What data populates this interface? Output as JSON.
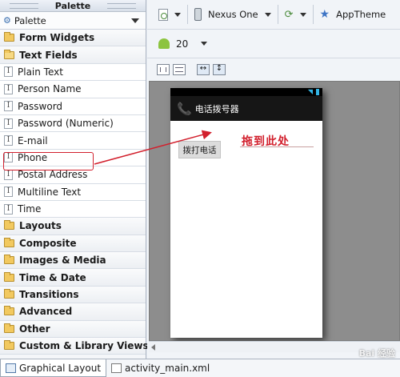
{
  "palette": {
    "title": "Palette",
    "dropdown_label": "Palette",
    "rows": [
      {
        "type": "category",
        "label": "Form Widgets",
        "open": false
      },
      {
        "type": "category",
        "label": "Text Fields",
        "open": true
      },
      {
        "type": "item",
        "label": "Plain Text"
      },
      {
        "type": "item",
        "label": "Person Name"
      },
      {
        "type": "item",
        "label": "Password"
      },
      {
        "type": "item",
        "label": "Password (Numeric)"
      },
      {
        "type": "item",
        "label": "E-mail"
      },
      {
        "type": "item",
        "label": "Phone"
      },
      {
        "type": "item",
        "label": "Postal Address"
      },
      {
        "type": "item",
        "label": "Multiline Text"
      },
      {
        "type": "item",
        "label": "Time"
      },
      {
        "type": "category",
        "label": "Layouts",
        "open": false
      },
      {
        "type": "category",
        "label": "Composite",
        "open": false
      },
      {
        "type": "category",
        "label": "Images & Media",
        "open": false
      },
      {
        "type": "category",
        "label": "Time & Date",
        "open": false
      },
      {
        "type": "category",
        "label": "Transitions",
        "open": false
      },
      {
        "type": "category",
        "label": "Advanced",
        "open": false
      },
      {
        "type": "category",
        "label": "Other",
        "open": false
      },
      {
        "type": "category",
        "label": "Custom & Library Views",
        "open": false
      }
    ]
  },
  "toolbar": {
    "device": "Nexus One",
    "theme": "AppTheme",
    "api_level": "20"
  },
  "device_preview": {
    "app_title": "电话拨号器",
    "button_label": "拨打电话"
  },
  "annotation": {
    "drop_text": "拖到此处",
    "color": "#d2202d"
  },
  "tabs": [
    {
      "label": "Graphical Layout",
      "active": true
    },
    {
      "label": "activity_main.xml",
      "active": false
    }
  ],
  "watermark": "Bai 经验"
}
